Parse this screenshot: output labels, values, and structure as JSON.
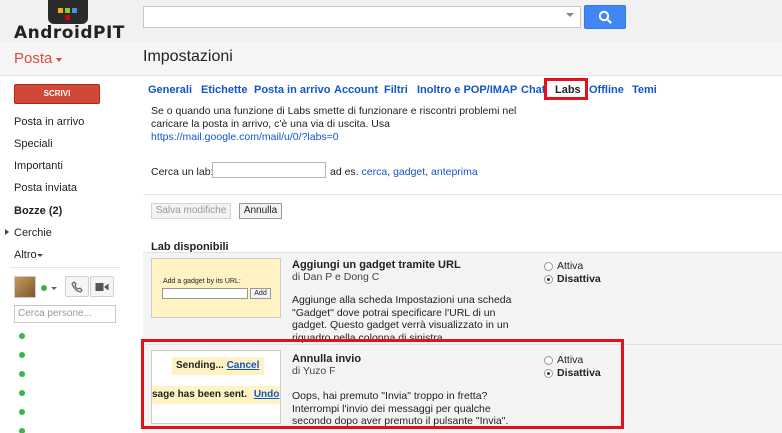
{
  "brand": {
    "logo_text": "AndroidPIT"
  },
  "app": {
    "menu_label": "Posta",
    "page_title": "Impostazioni"
  },
  "sidebar": {
    "compose_label": "SCRIVI",
    "items": [
      {
        "label": "Posta in arrivo"
      },
      {
        "label": "Speciali"
      },
      {
        "label": "Importanti"
      },
      {
        "label": "Posta inviata"
      },
      {
        "label": "Bozze (2)"
      },
      {
        "label": "Cerchie"
      },
      {
        "label": "Altro"
      }
    ],
    "people_search_placeholder": "Cerca persone..."
  },
  "tabs": [
    {
      "label": "Generali"
    },
    {
      "label": "Etichette"
    },
    {
      "label": "Posta in arrivo"
    },
    {
      "label": "Account"
    },
    {
      "label": "Filtri"
    },
    {
      "label": "Inoltro e POP/IMAP"
    },
    {
      "label": "Chat"
    },
    {
      "label": "Labs"
    },
    {
      "label": "Offline"
    },
    {
      "label": "Temi"
    }
  ],
  "content": {
    "intro_line1": "Se o quando una funzione di Labs smette di funzionare e riscontri problemi nel",
    "intro_line2": "caricare la posta in arrivo, c'è una via di uscita. Usa",
    "intro_link": "https://mail.google.com/mail/u/0/?labs=0",
    "search_label": "Cerca un lab:",
    "search_hint_prefix": "ad es.",
    "search_hint_1": "cerca",
    "search_hint_2": "gadget",
    "search_hint_3": "anteprima",
    "save_label": "Salva modifiche",
    "cancel_label": "Annulla",
    "labs_heading": "Lab disponibili"
  },
  "labs": [
    {
      "title": "Aggiungi un gadget tramite URL",
      "author": "di Dan P e Dong C",
      "description": "Aggiunge alla scheda Impostazioni una scheda \"Gadget\" dove potrai specificare l'URL di un gadget. Questo gadget verrà visualizzato in un riquadro nella colonna di sinistra.",
      "preview_label": "Add a gadget by its URL:",
      "preview_button": "Add",
      "option_on": "Attiva",
      "option_off": "Disattiva",
      "selected": "Disattiva"
    },
    {
      "title": "Annulla invio",
      "author": "di Yuzo F",
      "description": "Oops, hai premuto \"Invia\" troppo in fretta? Interrompi l'invio dei messaggi per qualche secondo dopo aver premuto il pulsante \"Invia\".",
      "preview_sending": "Sending...",
      "preview_cancel": "Cancel",
      "preview_sent": "sage has been sent.",
      "preview_undo": "Undo",
      "option_on": "Attiva",
      "option_off": "Disattiva",
      "selected": "Disattiva"
    }
  ],
  "colors": {
    "accent_red": "#dd4b39",
    "compose_red": "#d14836",
    "link_blue": "#1155cc",
    "search_blue": "#4285f4",
    "highlight_red": "#e3111b",
    "online_green": "#39b54a"
  },
  "icons": {
    "search_button": "magnifier-icon",
    "phone": "phone-icon",
    "video": "video-icon"
  }
}
